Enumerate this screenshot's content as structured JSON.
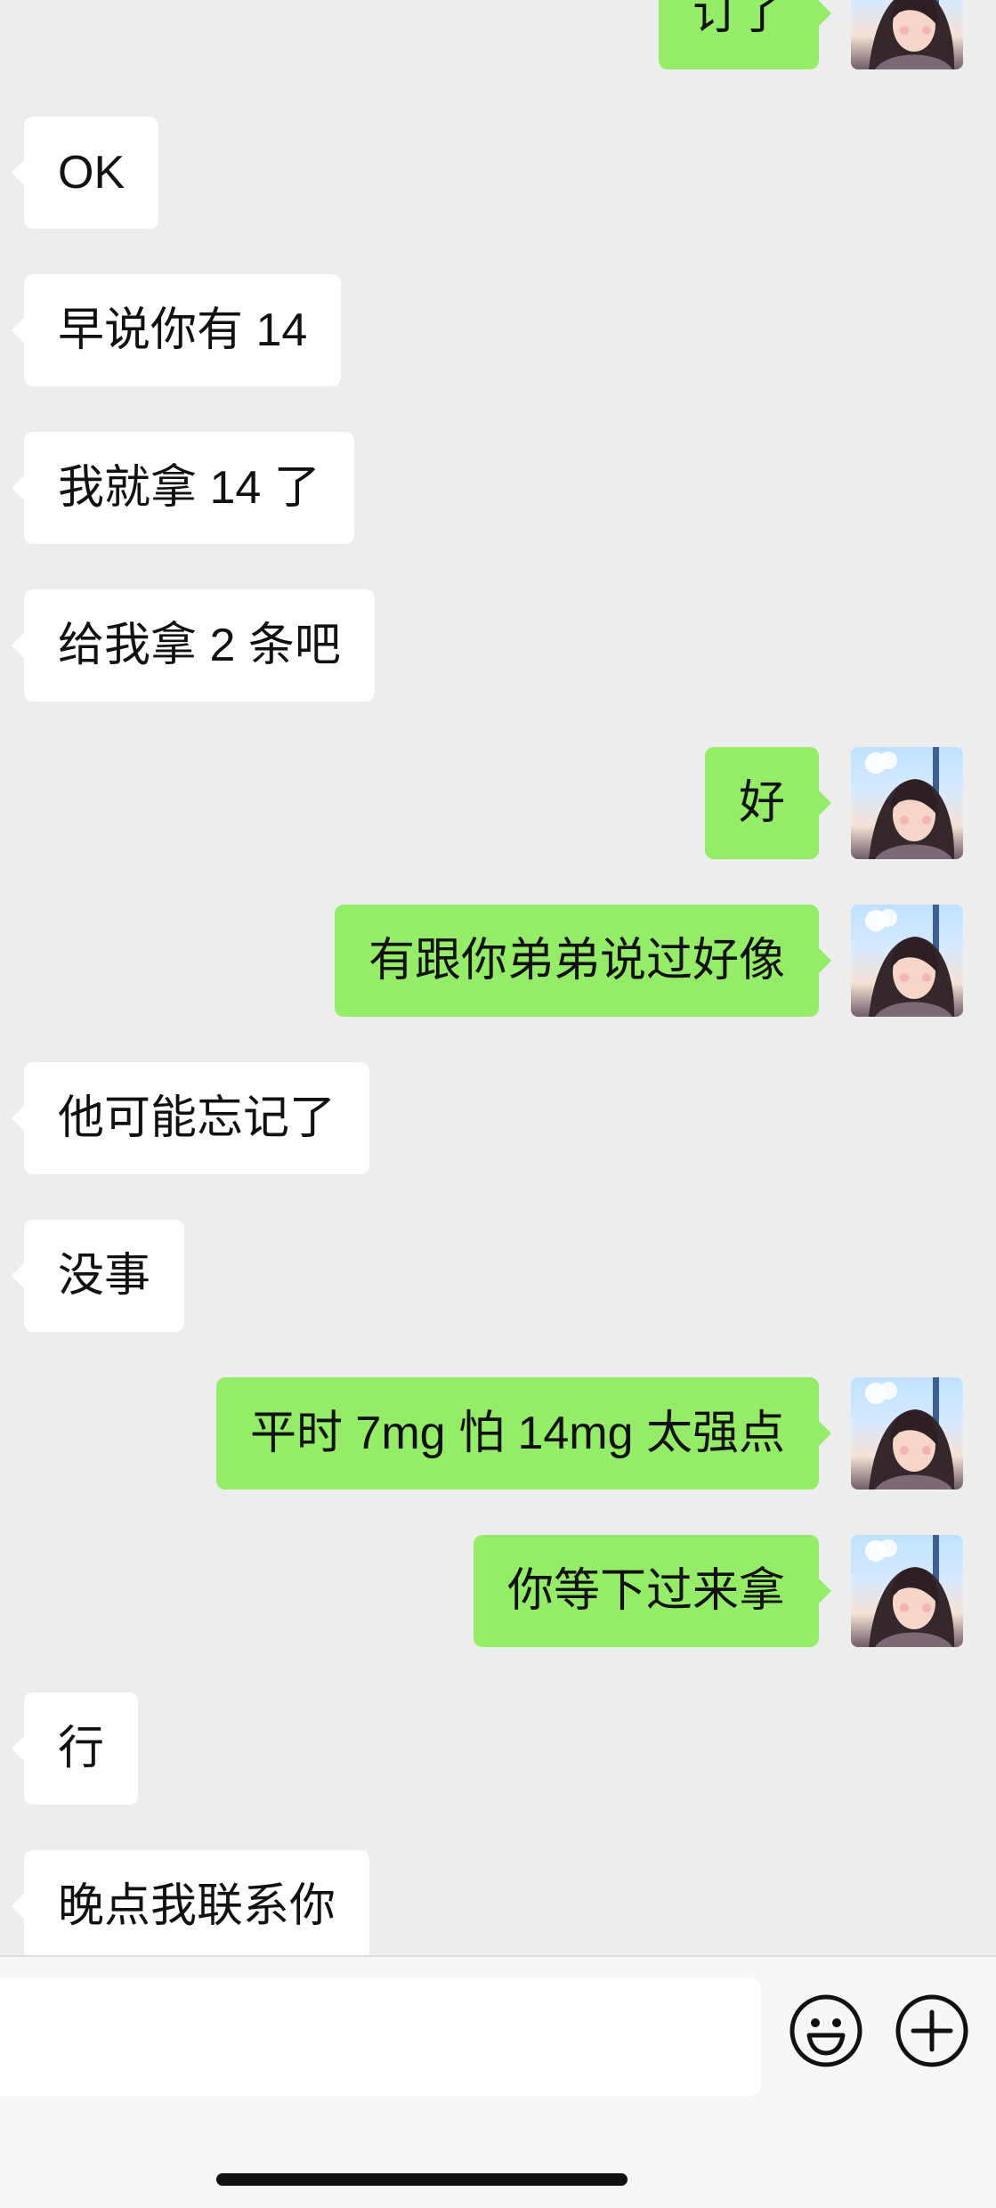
{
  "theme": {
    "background": "#ededed",
    "incoming_bubble": "#ffffff",
    "outgoing_bubble": "#95ec69"
  },
  "messages": [
    {
      "side": "right",
      "text": "订了"
    },
    {
      "side": "left",
      "text": "OK"
    },
    {
      "side": "left",
      "text": "早说你有 14"
    },
    {
      "side": "left",
      "text": "我就拿 14 了"
    },
    {
      "side": "left",
      "text": "给我拿 2 条吧"
    },
    {
      "side": "right",
      "text": "好"
    },
    {
      "side": "right",
      "text": "有跟你弟弟说过好像"
    },
    {
      "side": "left",
      "text": "他可能忘记了"
    },
    {
      "side": "left",
      "text": "没事"
    },
    {
      "side": "right",
      "text": "平时 7mg 怕 14mg 太强点"
    },
    {
      "side": "right",
      "text": "你等下过来拿"
    },
    {
      "side": "left",
      "text": "行"
    },
    {
      "side": "left",
      "text": "晚点我联系你"
    }
  ],
  "input_bar": {
    "value": "",
    "emoji_icon": "emoji-icon",
    "plus_icon": "plus-icon"
  }
}
